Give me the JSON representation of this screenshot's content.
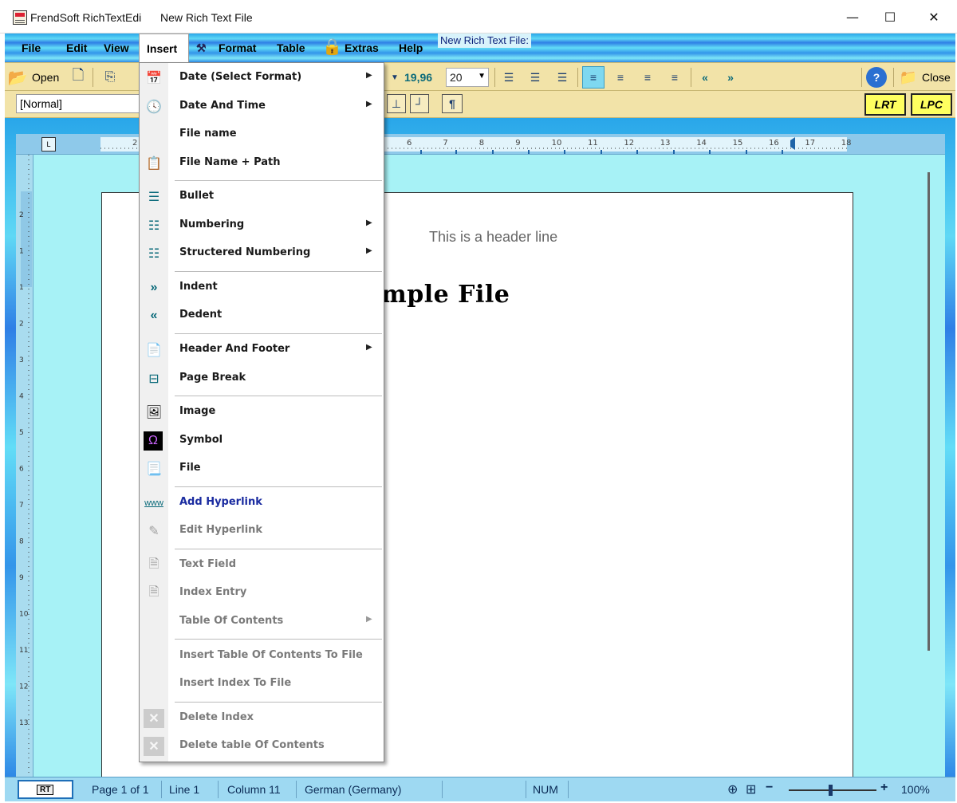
{
  "window": {
    "app_name": "FrendSoft RichTextEdi",
    "doc_name": "New Rich Text File",
    "minimize": "—",
    "maximize": "☐",
    "close": "✕"
  },
  "menubar": {
    "items": [
      "File",
      "Edit",
      "View",
      "Insert",
      "Format",
      "Table",
      "Extras",
      "Help"
    ],
    "doc_tab": "New Rich Text File:"
  },
  "toolbar1": {
    "open": "Open",
    "font_size_value": "19,96",
    "font_size": "20",
    "close": "Close"
  },
  "toolbar2": {
    "style": "[Normal]",
    "lrt": "LRT",
    "lpc": "LPC"
  },
  "ruler": {
    "labels_left": [
      "2"
    ],
    "labels_right": [
      "6",
      "7",
      "8",
      "9",
      "10",
      "11",
      "12",
      "13",
      "14",
      "15",
      "16",
      "17",
      "18"
    ]
  },
  "vruler": {
    "labels": [
      "2",
      "1",
      "1",
      "2",
      "3",
      "4",
      "5",
      "6",
      "7",
      "8",
      "9",
      "10",
      "11",
      "12",
      "13"
    ]
  },
  "document": {
    "header_line": "This is a header line",
    "title_fragment": "mple File"
  },
  "insert_menu": {
    "items": [
      {
        "label": "Date (Select Format)",
        "submenu": true,
        "enabled": true
      },
      {
        "label": "Date And Time",
        "submenu": true,
        "enabled": true
      },
      {
        "label": "File name",
        "submenu": false,
        "enabled": true
      },
      {
        "label": "File Name + Path",
        "submenu": false,
        "enabled": true
      },
      {
        "label": "Bullet",
        "submenu": false,
        "enabled": true
      },
      {
        "label": "Numbering",
        "submenu": true,
        "enabled": true
      },
      {
        "label": "Structered Numbering",
        "submenu": true,
        "enabled": true
      },
      {
        "label": "Indent",
        "submenu": false,
        "enabled": true
      },
      {
        "label": "Dedent",
        "submenu": false,
        "enabled": true
      },
      {
        "label": "Header And Footer",
        "submenu": true,
        "enabled": true
      },
      {
        "label": "Page Break",
        "submenu": false,
        "enabled": true
      },
      {
        "label": "Image",
        "submenu": false,
        "enabled": true
      },
      {
        "label": "Symbol",
        "submenu": false,
        "enabled": true
      },
      {
        "label": "File",
        "submenu": false,
        "enabled": true
      },
      {
        "label": "Add Hyperlink",
        "submenu": false,
        "enabled": true
      },
      {
        "label": "Edit Hyperlink",
        "submenu": false,
        "enabled": false
      },
      {
        "label": "Text Field",
        "submenu": false,
        "enabled": false
      },
      {
        "label": "Index Entry",
        "submenu": false,
        "enabled": false
      },
      {
        "label": "Table Of Contents",
        "submenu": true,
        "enabled": false
      },
      {
        "label": "Insert Table Of Contents To File",
        "submenu": false,
        "enabled": false
      },
      {
        "label": "Insert Index To File",
        "submenu": false,
        "enabled": false
      },
      {
        "label": "Delete Index",
        "submenu": false,
        "enabled": false
      },
      {
        "label": "Delete table Of Contents",
        "submenu": false,
        "enabled": false
      }
    ],
    "arrow": "▶",
    "hyperlink_icon_text": "www"
  },
  "statusbar": {
    "rt_badge": "RT",
    "page": "Page 1 of 1",
    "line": "Line 1",
    "column": "Column 11",
    "language": "German (Germany)",
    "num": "NUM",
    "zoom_minus": "−",
    "zoom_plus": "+",
    "zoom": "100%"
  },
  "colors": {
    "toolbar_bg": "#f2e3a8",
    "accent_teal": "#0a6a7a",
    "link_blue": "#1a2ba0",
    "page_bg": "#a7f2f6"
  }
}
